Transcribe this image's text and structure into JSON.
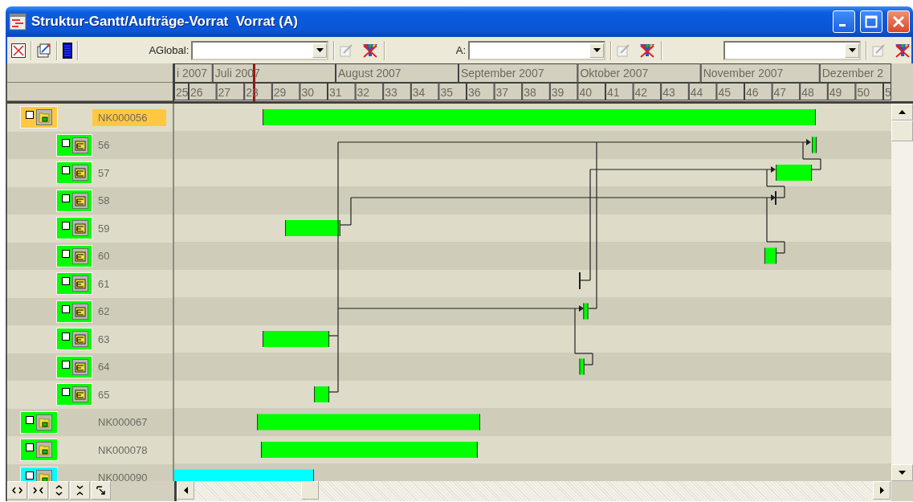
{
  "window": {
    "title": "Struktur-Gantt/Aufträge-Vorrat  Vorrat (A)"
  },
  "toolbar": {
    "filters": [
      {
        "kind": "combo",
        "label": "AGlobal:"
      },
      {
        "kind": "combo",
        "label": "A:"
      },
      {
        "kind": "combo"
      }
    ]
  },
  "timeline": {
    "months": [
      {
        "label": "i 2007"
      },
      {
        "label": "Juli 2007"
      },
      {
        "label": "August 2007"
      },
      {
        "label": "September 2007"
      },
      {
        "label": "Oktober 2007"
      },
      {
        "label": "November 2007"
      },
      {
        "label": "Dezember 2"
      }
    ],
    "weeks": [
      "25",
      "26",
      "27",
      "28",
      "29",
      "30",
      "31",
      "32",
      "33",
      "34",
      "35",
      "36",
      "37",
      "38",
      "39",
      "40",
      "41",
      "42",
      "43",
      "44",
      "45",
      "46",
      "47",
      "48",
      "49",
      "50",
      "5"
    ]
  },
  "tree": [
    {
      "label": "NK000056",
      "kind": "order",
      "selected": true,
      "checked": false,
      "bar": {
        "color": "#00ff00"
      },
      "children": [
        {
          "label": "56",
          "kind": "operation",
          "selected": false,
          "checked": false,
          "color": "#00ff00",
          "bar": {
            "color": "#00ff00"
          }
        },
        {
          "label": "57",
          "kind": "operation",
          "selected": false,
          "checked": false,
          "color": "#00ff00",
          "bar": {
            "color": "#00ff00"
          }
        },
        {
          "label": "58",
          "kind": "operation",
          "selected": false,
          "checked": false,
          "color": "#00ff00"
        },
        {
          "label": "59",
          "kind": "operation",
          "selected": false,
          "checked": false,
          "color": "#00ff00",
          "bar": {
            "color": "#00ff00"
          }
        },
        {
          "label": "60",
          "kind": "operation",
          "selected": false,
          "checked": false,
          "color": "#00ff00",
          "bar": {
            "color": "#00ff00"
          }
        },
        {
          "label": "61",
          "kind": "operation",
          "selected": false,
          "checked": false,
          "color": "#00ff00"
        },
        {
          "label": "62",
          "kind": "operation",
          "selected": false,
          "checked": false,
          "color": "#00ff00",
          "bar": {
            "color": "#00ff00"
          }
        },
        {
          "label": "63",
          "kind": "operation",
          "selected": false,
          "checked": false,
          "color": "#00ff00",
          "bar": {
            "color": "#00ff00"
          }
        },
        {
          "label": "64",
          "kind": "operation",
          "selected": false,
          "checked": false,
          "color": "#00ff00",
          "bar": {
            "color": "#00ff00"
          }
        },
        {
          "label": "65",
          "kind": "operation",
          "selected": false,
          "checked": false,
          "color": "#00ff00",
          "bar": {
            "color": "#00ff00"
          }
        }
      ]
    },
    {
      "label": "NK000067",
      "kind": "order",
      "selected": false,
      "checked": false,
      "color": "#00ff00",
      "bar": {
        "color": "#00ff00"
      }
    },
    {
      "label": "NK000078",
      "kind": "order",
      "selected": false,
      "checked": false,
      "color": "#00ff00",
      "bar": {
        "color": "#00ff00"
      }
    },
    {
      "label": "NK000090",
      "kind": "order",
      "selected": false,
      "checked": false,
      "color": "#00ffff",
      "bar": {
        "color": "#00ffff"
      }
    }
  ]
}
